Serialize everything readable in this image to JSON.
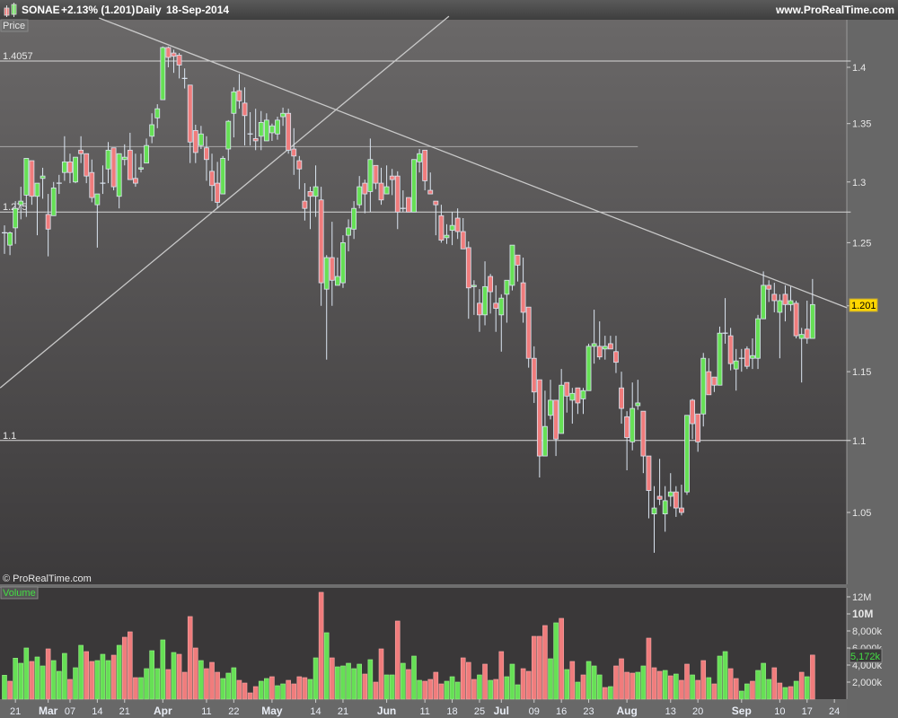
{
  "header": {
    "symbol": "SONAE",
    "change": "+2.13% (1.201)",
    "period": "Daily",
    "date": "18-Sep-2014",
    "site": "www.ProRealTime.com"
  },
  "panels": {
    "price_label": "Price",
    "volume_label": "Volume",
    "copyright": "© ProRealTime.com"
  },
  "colors": {
    "up": "#66e055",
    "down": "#f07c7c",
    "outline": "#dce6f2",
    "tag_bg": "#ffd700",
    "vol_tag_text": "#44dd44"
  },
  "chart_data": {
    "type": "candlestick",
    "title": "SONAE Daily",
    "scale": "log",
    "ylim": [
      1.003,
      1.45
    ],
    "price_ticks": [
      "1.4",
      "1.35",
      "1.3",
      "1.25",
      "1.2",
      "1.15",
      "1.1",
      "1.05"
    ],
    "last_price_tag": "1.201",
    "x_ticks": [
      {
        "label": "21",
        "bar": 3
      },
      {
        "label": "Mar",
        "bar": 9,
        "bold": true
      },
      {
        "label": "07",
        "bar": 13
      },
      {
        "label": "14",
        "bar": 18
      },
      {
        "label": "21",
        "bar": 23
      },
      {
        "label": "Apr",
        "bar": 30,
        "bold": true
      },
      {
        "label": "11",
        "bar": 38
      },
      {
        "label": "22",
        "bar": 43
      },
      {
        "label": "May",
        "bar": 50,
        "bold": true
      },
      {
        "label": "14",
        "bar": 58
      },
      {
        "label": "21",
        "bar": 63
      },
      {
        "label": "Jun",
        "bar": 71,
        "bold": true
      },
      {
        "label": "11",
        "bar": 78
      },
      {
        "label": "18",
        "bar": 83
      },
      {
        "label": "25",
        "bar": 88
      },
      {
        "label": "Jul",
        "bar": 92,
        "bold": true
      },
      {
        "label": "09",
        "bar": 98
      },
      {
        "label": "16",
        "bar": 103
      },
      {
        "label": "23",
        "bar": 108
      },
      {
        "label": "Aug",
        "bar": 115,
        "bold": true
      },
      {
        "label": "13",
        "bar": 123
      },
      {
        "label": "20",
        "bar": 128
      },
      {
        "label": "Sep",
        "bar": 136,
        "bold": true
      },
      {
        "label": "10",
        "bar": 143
      },
      {
        "label": "17",
        "bar": 148
      },
      {
        "label": "24",
        "bar": 153
      }
    ],
    "hlines": [
      {
        "price": 1.4057,
        "label": "1.4057",
        "to_bar": 156
      },
      {
        "price": 1.33,
        "label": "",
        "to_bar": 117
      },
      {
        "price": 1.275,
        "label": "1.275",
        "to_bar": 156
      },
      {
        "price": 1.1,
        "label": "1.1",
        "to_bar": 156
      }
    ],
    "trendlines": [
      {
        "from": [
          18.3,
          1.4454
        ],
        "to": [
          155.3,
          1.1985
        ]
      },
      {
        "from": [
          0.2,
          1.138
        ],
        "to": [
          82.4,
          1.447
        ]
      }
    ],
    "ohlc": [
      [
        1.258,
        1.264,
        1.241,
        1.258
      ],
      [
        1.248,
        1.259,
        1.24,
        1.258
      ],
      [
        1.262,
        1.284,
        1.249,
        1.278
      ],
      [
        1.281,
        1.296,
        1.269,
        1.284
      ],
      [
        1.289,
        1.32,
        1.271,
        1.32
      ],
      [
        1.318,
        1.318,
        1.281,
        1.288
      ],
      [
        1.288,
        1.299,
        1.256,
        1.299
      ],
      [
        1.303,
        1.312,
        1.286,
        1.305
      ],
      [
        1.273,
        1.29,
        1.239,
        1.261
      ],
      [
        1.272,
        1.3,
        1.272,
        1.295
      ],
      [
        1.299,
        1.306,
        1.29,
        1.299
      ],
      [
        1.308,
        1.339,
        1.301,
        1.317
      ],
      [
        1.317,
        1.324,
        1.299,
        1.308
      ],
      [
        1.3,
        1.321,
        1.299,
        1.321
      ],
      [
        1.327,
        1.339,
        1.316,
        1.324
      ],
      [
        1.324,
        1.324,
        1.299,
        1.305
      ],
      [
        1.308,
        1.319,
        1.283,
        1.287
      ],
      [
        1.281,
        1.29,
        1.246,
        1.29
      ],
      [
        1.299,
        1.314,
        1.29,
        1.299
      ],
      [
        1.311,
        1.334,
        1.299,
        1.327
      ],
      [
        1.329,
        1.329,
        1.293,
        1.296
      ],
      [
        1.288,
        1.324,
        1.278,
        1.324
      ],
      [
        1.319,
        1.332,
        1.314,
        1.321
      ],
      [
        1.327,
        1.342,
        1.302,
        1.302
      ],
      [
        1.303,
        1.324,
        1.296,
        1.299
      ],
      [
        1.311,
        1.324,
        1.308,
        1.312
      ],
      [
        1.316,
        1.337,
        1.316,
        1.331
      ],
      [
        1.339,
        1.359,
        1.333,
        1.349
      ],
      [
        1.355,
        1.367,
        1.346,
        1.363
      ],
      [
        1.371,
        1.419,
        1.371,
        1.418
      ],
      [
        1.418,
        1.419,
        1.4,
        1.409
      ],
      [
        1.413,
        1.416,
        1.395,
        1.41
      ],
      [
        1.411,
        1.413,
        1.39,
        1.402
      ],
      [
        1.39,
        1.399,
        1.381,
        1.39
      ],
      [
        1.384,
        1.384,
        1.316,
        1.334
      ],
      [
        1.344,
        1.349,
        1.316,
        1.325
      ],
      [
        1.331,
        1.348,
        1.328,
        1.341
      ],
      [
        1.329,
        1.339,
        1.301,
        1.319
      ],
      [
        1.309,
        1.324,
        1.284,
        1.297
      ],
      [
        1.299,
        1.317,
        1.278,
        1.283
      ],
      [
        1.29,
        1.322,
        1.29,
        1.32
      ],
      [
        1.328,
        1.353,
        1.318,
        1.352
      ],
      [
        1.359,
        1.382,
        1.338,
        1.378
      ],
      [
        1.379,
        1.394,
        1.363,
        1.37
      ],
      [
        1.368,
        1.382,
        1.331,
        1.357
      ],
      [
        1.341,
        1.36,
        1.331,
        1.341
      ],
      [
        1.337,
        1.363,
        1.327,
        1.335
      ],
      [
        1.339,
        1.361,
        1.327,
        1.351
      ],
      [
        1.335,
        1.359,
        1.335,
        1.353
      ],
      [
        1.342,
        1.35,
        1.335,
        1.348
      ],
      [
        1.341,
        1.356,
        1.336,
        1.353
      ],
      [
        1.356,
        1.364,
        1.348,
        1.359
      ],
      [
        1.359,
        1.363,
        1.324,
        1.327
      ],
      [
        1.328,
        1.346,
        1.306,
        1.322
      ],
      [
        1.318,
        1.322,
        1.294,
        1.311
      ],
      [
        1.284,
        1.299,
        1.268,
        1.278
      ],
      [
        1.292,
        1.296,
        1.261,
        1.288
      ],
      [
        1.288,
        1.314,
        1.271,
        1.296
      ],
      [
        1.285,
        1.296,
        1.2,
        1.218
      ],
      [
        1.213,
        1.24,
        1.159,
        1.238
      ],
      [
        1.238,
        1.267,
        1.2,
        1.22
      ],
      [
        1.216,
        1.238,
        1.216,
        1.223
      ],
      [
        1.218,
        1.256,
        1.214,
        1.25
      ],
      [
        1.256,
        1.269,
        1.243,
        1.262
      ],
      [
        1.261,
        1.284,
        1.253,
        1.278
      ],
      [
        1.281,
        1.305,
        1.278,
        1.296
      ],
      [
        1.299,
        1.302,
        1.274,
        1.29
      ],
      [
        1.292,
        1.337,
        1.275,
        1.319
      ],
      [
        1.314,
        1.314,
        1.294,
        1.299
      ],
      [
        1.299,
        1.312,
        1.281,
        1.285
      ],
      [
        1.29,
        1.314,
        1.29,
        1.296
      ],
      [
        1.305,
        1.311,
        1.289,
        1.302
      ],
      [
        1.305,
        1.309,
        1.261,
        1.275
      ],
      [
        1.278,
        1.293,
        1.275,
        1.278
      ],
      [
        1.287,
        1.287,
        1.275,
        1.275
      ],
      [
        1.275,
        1.319,
        1.275,
        1.319
      ],
      [
        1.317,
        1.328,
        1.308,
        1.324
      ],
      [
        1.327,
        1.327,
        1.293,
        1.301
      ],
      [
        1.293,
        1.308,
        1.29,
        1.29
      ],
      [
        1.284,
        1.284,
        1.256,
        1.281
      ],
      [
        1.272,
        1.281,
        1.25,
        1.252
      ],
      [
        1.254,
        1.265,
        1.249,
        1.256
      ],
      [
        1.26,
        1.275,
        1.248,
        1.264
      ],
      [
        1.27,
        1.278,
        1.253,
        1.259
      ],
      [
        1.259,
        1.27,
        1.245,
        1.245
      ],
      [
        1.246,
        1.251,
        1.19,
        1.214
      ],
      [
        1.215,
        1.22,
        1.193,
        1.216
      ],
      [
        1.202,
        1.213,
        1.18,
        1.193
      ],
      [
        1.193,
        1.235,
        1.185,
        1.215
      ],
      [
        1.223,
        1.225,
        1.194,
        1.211
      ],
      [
        1.202,
        1.216,
        1.18,
        1.198
      ],
      [
        1.193,
        1.209,
        1.165,
        1.206
      ],
      [
        1.209,
        1.22,
        1.187,
        1.22
      ],
      [
        1.216,
        1.248,
        1.212,
        1.248
      ],
      [
        1.24,
        1.24,
        1.219,
        1.232
      ],
      [
        1.218,
        1.238,
        1.187,
        1.195
      ],
      [
        1.199,
        1.199,
        1.153,
        1.16
      ],
      [
        1.16,
        1.169,
        1.127,
        1.135
      ],
      [
        1.144,
        1.144,
        1.074,
        1.089
      ],
      [
        1.089,
        1.136,
        1.089,
        1.11
      ],
      [
        1.118,
        1.144,
        1.115,
        1.129
      ],
      [
        1.129,
        1.129,
        1.089,
        1.101
      ],
      [
        1.105,
        1.152,
        1.105,
        1.14
      ],
      [
        1.142,
        1.142,
        1.12,
        1.132
      ],
      [
        1.129,
        1.138,
        1.112,
        1.134
      ],
      [
        1.138,
        1.138,
        1.119,
        1.127
      ],
      [
        1.13,
        1.138,
        1.119,
        1.136
      ],
      [
        1.136,
        1.171,
        1.136,
        1.169
      ],
      [
        1.169,
        1.197,
        1.156,
        1.171
      ],
      [
        1.169,
        1.188,
        1.159,
        1.161
      ],
      [
        1.167,
        1.177,
        1.159,
        1.169
      ],
      [
        1.171,
        1.177,
        1.167,
        1.167
      ],
      [
        1.165,
        1.177,
        1.149,
        1.157
      ],
      [
        1.138,
        1.15,
        1.112,
        1.123
      ],
      [
        1.117,
        1.121,
        1.079,
        1.102
      ],
      [
        1.099,
        1.142,
        1.093,
        1.123
      ],
      [
        1.125,
        1.144,
        1.122,
        1.127
      ],
      [
        1.121,
        1.121,
        1.077,
        1.089
      ],
      [
        1.089,
        1.089,
        1.046,
        1.065
      ],
      [
        1.049,
        1.068,
        1.023,
        1.053
      ],
      [
        1.061,
        1.087,
        1.055,
        1.059
      ],
      [
        1.049,
        1.068,
        1.037,
        1.058
      ],
      [
        1.061,
        1.077,
        1.054,
        1.064
      ],
      [
        1.064,
        1.068,
        1.047,
        1.053
      ],
      [
        1.053,
        1.069,
        1.048,
        1.05
      ],
      [
        1.064,
        1.118,
        1.062,
        1.118
      ],
      [
        1.129,
        1.13,
        1.101,
        1.112
      ],
      [
        1.119,
        1.119,
        1.092,
        1.099
      ],
      [
        1.119,
        1.164,
        1.11,
        1.16
      ],
      [
        1.15,
        1.16,
        1.133,
        1.133
      ],
      [
        1.146,
        1.146,
        1.135,
        1.14
      ],
      [
        1.14,
        1.184,
        1.14,
        1.179
      ],
      [
        1.179,
        1.206,
        1.171,
        1.179
      ],
      [
        1.177,
        1.183,
        1.151,
        1.156
      ],
      [
        1.152,
        1.167,
        1.136,
        1.158
      ],
      [
        1.16,
        1.167,
        1.15,
        1.16
      ],
      [
        1.167,
        1.169,
        1.152,
        1.154
      ],
      [
        1.16,
        1.175,
        1.152,
        1.162
      ],
      [
        1.16,
        1.193,
        1.152,
        1.19
      ],
      [
        1.19,
        1.227,
        1.19,
        1.216
      ],
      [
        1.216,
        1.22,
        1.203,
        1.213
      ],
      [
        1.209,
        1.218,
        1.195,
        1.204
      ],
      [
        1.195,
        1.209,
        1.16,
        1.204
      ],
      [
        1.209,
        1.216,
        1.188,
        1.201
      ],
      [
        1.201,
        1.215,
        1.196,
        1.204
      ],
      [
        1.202,
        1.204,
        1.175,
        1.177
      ],
      [
        1.175,
        1.183,
        1.142,
        1.178
      ],
      [
        1.182,
        1.204,
        1.171,
        1.175
      ],
      [
        1.175,
        1.221,
        1.175,
        1.201
      ]
    ],
    "volume": {
      "unit": "k",
      "ylim": [
        0,
        13000
      ],
      "ticks": [
        {
          "label": "12M",
          "value": 12000
        },
        {
          "label": "10M",
          "value": 10000,
          "bold": true
        },
        {
          "label": "8,000k",
          "value": 8000
        },
        {
          "label": "6,000k",
          "value": 6000
        },
        {
          "label": "4,000k",
          "value": 4000
        },
        {
          "label": "2,000k",
          "value": 2000
        }
      ],
      "last_tag": "5,172k",
      "directions": "grgggrggrgggrggrrgggrgrrrgggggrgrrrrgrrrgggrrrrggrggrrrrggrgrgggggrgrrggrgrggrrrrgggrrrgrgrrgggrrrrrggrgrgrgggrgrrrrggrrrgrgrrgrrgrggrrggrgggrrgrgrgrg",
      "values": [
        2808,
        2106,
        4809,
        4212,
        6002,
        4423,
        4949,
        3896,
        5897,
        4528,
        3264,
        5370,
        2317,
        3686,
        6318,
        5581,
        4423,
        4528,
        5265,
        4528,
        5160,
        6318,
        7266,
        7898,
        2527,
        2527,
        3580,
        5686,
        3580,
        6950,
        3475,
        5476,
        5265,
        3159,
        9688,
        6002,
        4528,
        3580,
        4317,
        3159,
        2422,
        3054,
        3686,
        2211,
        1895,
        737,
        1474,
        2106,
        2422,
        2633,
        1580,
        1790,
        2211,
        1790,
        2633,
        2527,
        2317,
        4844,
        12531,
        7792,
        4844,
        3791,
        3896,
        4212,
        3580,
        4107,
        2948,
        4633,
        2001,
        5897,
        2843,
        2843,
        9161,
        4212,
        3475,
        5054,
        2211,
        2106,
        2317,
        3159,
        1790,
        2106,
        2633,
        2001,
        4844,
        4317,
        2317,
        2843,
        4107,
        2211,
        2317,
        5581,
        2633,
        4107,
        1685,
        3580,
        3264,
        7371,
        7371,
        8635,
        4739,
        8951,
        9477,
        3475,
        4423,
        2001,
        2843,
        4423,
        3896,
        2843,
        1369,
        1474,
        3896,
        4739,
        3159,
        3054,
        3159,
        3896,
        7160,
        3686,
        3264,
        3370,
        2738,
        2948,
        2211,
        4107,
        2843,
        2211,
        4528,
        2527,
        1790,
        5054,
        5581,
        3580,
        2422,
        948,
        1790,
        2106,
        3370,
        4212,
        2317,
        3686,
        1895,
        1369,
        1474,
        2106,
        3159,
        2633,
        5172
      ]
    }
  }
}
